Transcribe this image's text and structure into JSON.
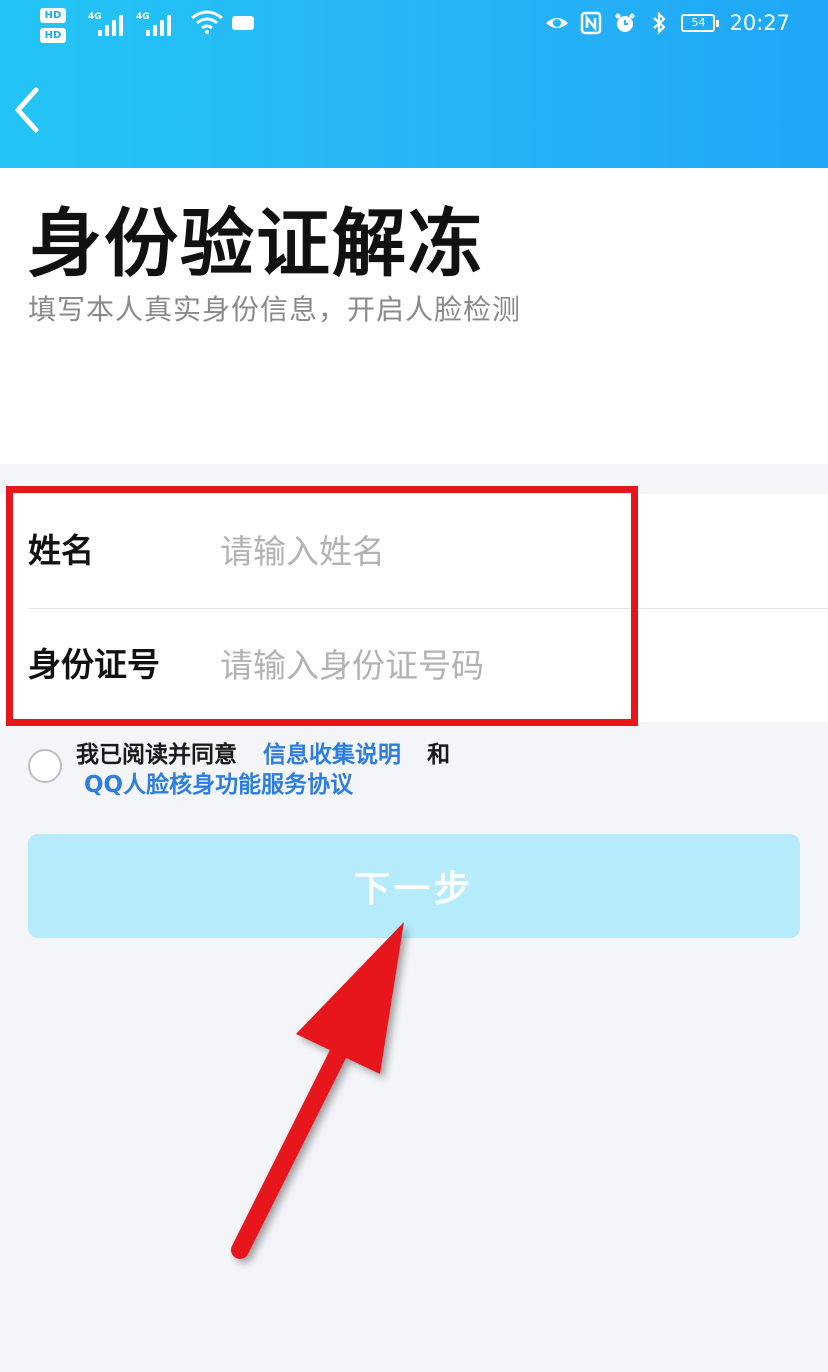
{
  "status_bar": {
    "hd_badges": [
      "HD",
      "HD"
    ],
    "network": [
      "4G",
      "4G"
    ],
    "battery": "54",
    "time": "20:27",
    "icons": [
      "eye-icon",
      "nfc-icon",
      "alarm-icon",
      "bluetooth-icon",
      "battery-icon",
      "wifi-icon",
      "signal-icon"
    ]
  },
  "header": {
    "back_icon": "chevron-left-icon",
    "accent": "#23c4f5"
  },
  "page": {
    "title": "身份验证解冻",
    "subtitle": "填写本人真实身份信息，开启人脸检测"
  },
  "form": {
    "name_label": "姓名",
    "name_placeholder": "请输入姓名",
    "id_label": "身份证号",
    "id_placeholder": "请输入身份证号码",
    "highlight_color": "#e6161e"
  },
  "agreement": {
    "prefix": "我已阅读并同意",
    "link1": "信息收集说明",
    "and": "和",
    "link2": "QQ人脸核身功能服务协议",
    "checked": false
  },
  "next_button": {
    "label": "下一步",
    "color": "#b5ebfb"
  },
  "annotation": {
    "arrow_color": "#e6161e"
  }
}
